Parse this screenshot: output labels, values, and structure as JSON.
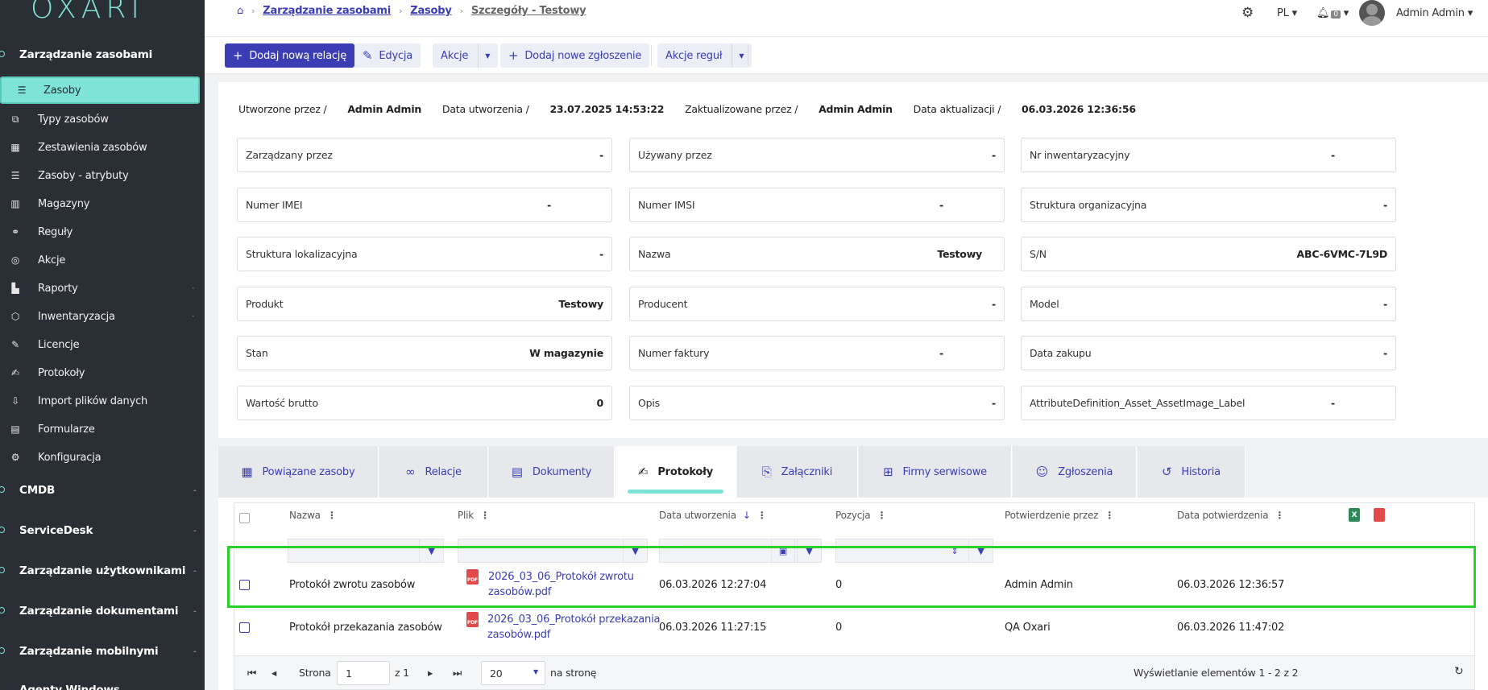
{
  "app": {
    "logo": "OXARI"
  },
  "sidebar": {
    "group_assets": "Zarządzanie zasobami",
    "items": [
      {
        "label": "Zasoby",
        "icon": "list-icon"
      },
      {
        "label": "Typy zasobów",
        "icon": "shapes-icon"
      },
      {
        "label": "Zestawienia zasobów",
        "icon": "table-icon"
      },
      {
        "label": "Zasoby - atrybuty",
        "icon": "list-icon"
      },
      {
        "label": "Magazyny",
        "icon": "warehouse-icon"
      },
      {
        "label": "Reguły",
        "icon": "rules-icon"
      },
      {
        "label": "Akcje",
        "icon": "target-icon"
      },
      {
        "label": "Raporty",
        "icon": "chart-icon"
      },
      {
        "label": "Inwentaryzacja",
        "icon": "box-icon"
      },
      {
        "label": "Licencje",
        "icon": "license-icon"
      },
      {
        "label": "Protokoły",
        "icon": "protocol-icon"
      },
      {
        "label": "Import plików danych",
        "icon": "import-icon"
      },
      {
        "label": "Formularze",
        "icon": "form-icon"
      },
      {
        "label": "Konfiguracja",
        "icon": "gears-icon"
      }
    ],
    "groups": [
      "CMDB",
      "ServiceDesk",
      "Zarządzanie użytkownikami",
      "Zarządzanie dokumentami",
      "Zarządzanie mobilnymi",
      "Agenty Windows"
    ]
  },
  "header": {
    "breadcrumb": [
      "Zarządzanie zasobami",
      "Zasoby",
      "Szczegóły - Testowy"
    ],
    "lang": "PL",
    "notifications": "0",
    "user": "Admin Admin"
  },
  "toolbar": {
    "add_relation": "Dodaj nową relację",
    "edit": "Edycja",
    "actions": "Akcje",
    "add_ticket": "Dodaj nowe zgłoszenie",
    "rule_actions": "Akcje reguł"
  },
  "meta": {
    "created_by_label": "Utworzone przez /",
    "created_by": "Admin Admin",
    "created_date_label": "Data utworzenia /",
    "created_date": "23.07.2025 14:53:22",
    "updated_by_label": "Zaktualizowane przez /",
    "updated_by": "Admin Admin",
    "updated_date_label": "Data aktualizacji /",
    "updated_date": "06.03.2026 12:36:56"
  },
  "fields": [
    [
      {
        "label": "Zarządzany przez",
        "value": "-"
      },
      {
        "label": "Używany przez",
        "value": "-"
      },
      {
        "label": "Nr inwentaryzacyjny",
        "value": "-"
      }
    ],
    [
      {
        "label": "Numer IMEI",
        "value": "-"
      },
      {
        "label": "Numer IMSI",
        "value": "-"
      },
      {
        "label": "Struktura organizacyjna",
        "value": "-"
      }
    ],
    [
      {
        "label": "Struktura lokalizacyjna",
        "value": "-"
      },
      {
        "label": "Nazwa",
        "value": "Testowy"
      },
      {
        "label": "S/N",
        "value": "ABC-6VMC-7L9D"
      }
    ],
    [
      {
        "label": "Produkt",
        "value": "Testowy"
      },
      {
        "label": "Producent",
        "value": "-"
      },
      {
        "label": "Model",
        "value": "-"
      }
    ],
    [
      {
        "label": "Stan",
        "value": "W magazynie"
      },
      {
        "label": "Numer faktury",
        "value": "-"
      },
      {
        "label": "Data zakupu",
        "value": "-"
      }
    ],
    [
      {
        "label": "Wartość brutto",
        "value": "0"
      },
      {
        "label": "Opis",
        "value": "-"
      },
      {
        "label": "AttributeDefinition_Asset_AssetImage_Label",
        "value": "-"
      }
    ]
  ],
  "tabs": [
    {
      "label": "Powiązane zasoby",
      "icon": "related-assets-icon"
    },
    {
      "label": "Relacje",
      "icon": "link-icon"
    },
    {
      "label": "Dokumenty",
      "icon": "document-icon"
    },
    {
      "label": "Protokoły",
      "icon": "protocol-icon"
    },
    {
      "label": "Załączniki",
      "icon": "attachment-icon"
    },
    {
      "label": "Firmy serwisowe",
      "icon": "org-icon"
    },
    {
      "label": "Zgłoszenia",
      "icon": "support-icon"
    },
    {
      "label": "Historia",
      "icon": "history-icon"
    }
  ],
  "grid": {
    "columns": [
      "Nazwa",
      "Plik",
      "Data utworzenia",
      "Pozycja",
      "Potwierdzenie przez",
      "Data potwierdzenia"
    ],
    "rows": [
      {
        "name": "Protokół zwrotu zasobów",
        "file1": "2026_03_06_Protokół zwrotu",
        "file2": "zasobów.pdf",
        "created": "06.03.2026 12:27:04",
        "position": "0",
        "confirmed_by": "Admin Admin",
        "confirmed_date": "06.03.2026 12:36:57"
      },
      {
        "name": "Protokół przekazania zasobów",
        "file1": "2026_03_06_Protokół przekazania",
        "file2": "zasobów.pdf",
        "created": "06.03.2026 11:27:15",
        "position": "0",
        "confirmed_by": "QA Oxari",
        "confirmed_date": "06.03.2026 11:47:02"
      }
    ],
    "pager": {
      "page_label": "Strona",
      "page": "1",
      "of": "z 1",
      "page_size": "20",
      "per_page": "na stronę",
      "summary": "Wyświetlanie elementów 1 - 2 z 2"
    }
  },
  "colors": {
    "accent": "#3b3db5",
    "teal": "#7fe3d8",
    "sidebar": "#2a2e35",
    "highlight": "#2bd02b"
  }
}
